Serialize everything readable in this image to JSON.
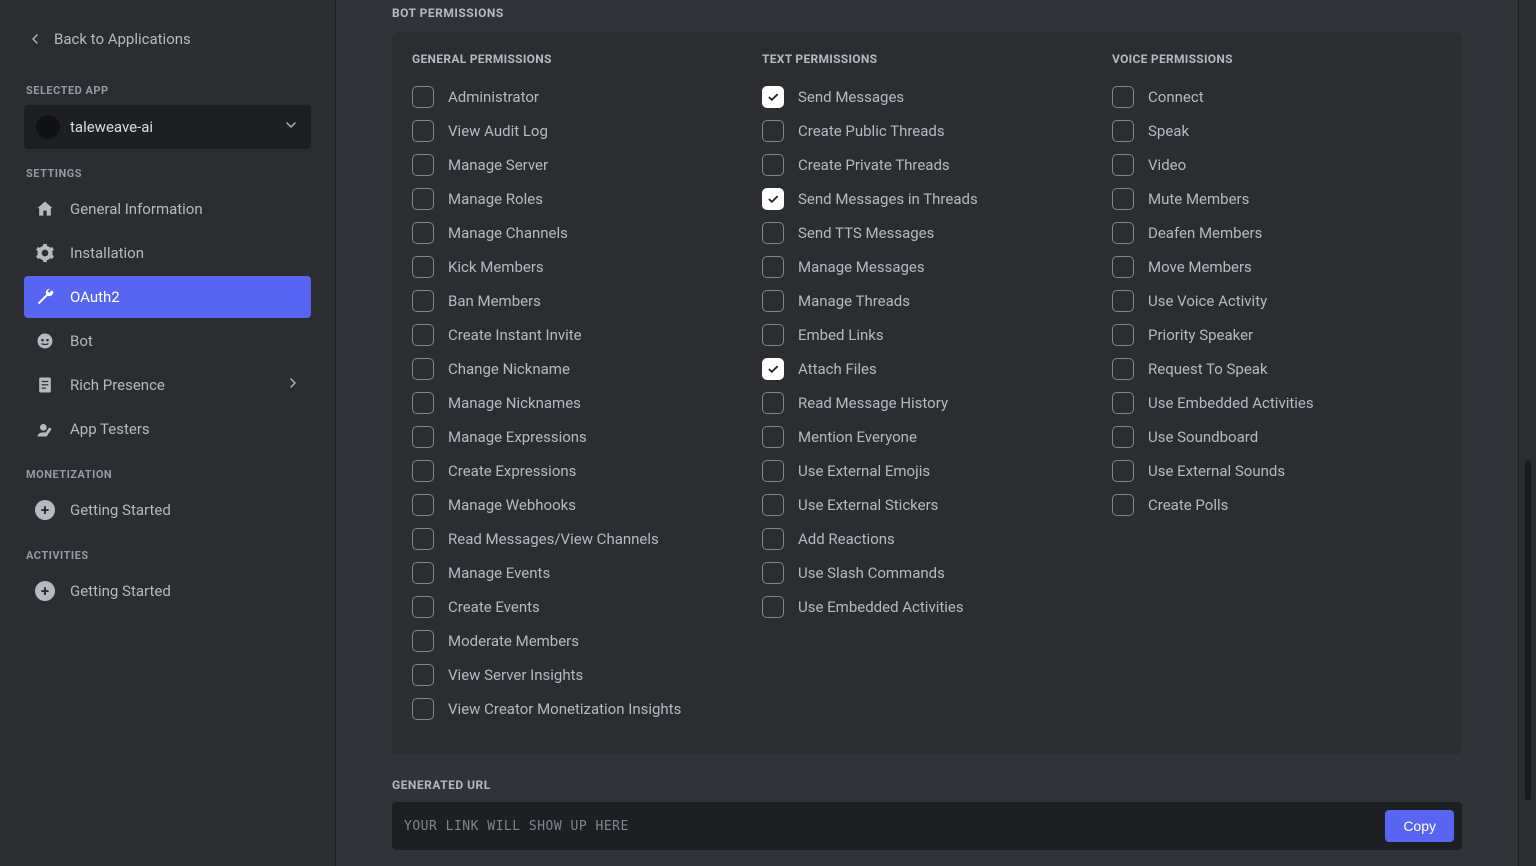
{
  "sidebar": {
    "back": "Back to Applications",
    "selected_app_header": "SELECTED APP",
    "app_name": "taleweave-ai",
    "settings_header": "SETTINGS",
    "nav": {
      "general": "General Information",
      "installation": "Installation",
      "oauth2": "OAuth2",
      "bot": "Bot",
      "rich_presence": "Rich Presence",
      "app_testers": "App Testers"
    },
    "monetization_header": "MONETIZATION",
    "monetization_getting_started": "Getting Started",
    "activities_header": "ACTIVITIES",
    "activities_getting_started": "Getting Started"
  },
  "main": {
    "title": "BOT PERMISSIONS",
    "columns": {
      "general": {
        "header": "GENERAL PERMISSIONS",
        "items": [
          {
            "label": "Administrator",
            "checked": false
          },
          {
            "label": "View Audit Log",
            "checked": false
          },
          {
            "label": "Manage Server",
            "checked": false
          },
          {
            "label": "Manage Roles",
            "checked": false
          },
          {
            "label": "Manage Channels",
            "checked": false
          },
          {
            "label": "Kick Members",
            "checked": false
          },
          {
            "label": "Ban Members",
            "checked": false
          },
          {
            "label": "Create Instant Invite",
            "checked": false
          },
          {
            "label": "Change Nickname",
            "checked": false
          },
          {
            "label": "Manage Nicknames",
            "checked": false
          },
          {
            "label": "Manage Expressions",
            "checked": false
          },
          {
            "label": "Create Expressions",
            "checked": false
          },
          {
            "label": "Manage Webhooks",
            "checked": false
          },
          {
            "label": "Read Messages/View Channels",
            "checked": false
          },
          {
            "label": "Manage Events",
            "checked": false
          },
          {
            "label": "Create Events",
            "checked": false
          },
          {
            "label": "Moderate Members",
            "checked": false
          },
          {
            "label": "View Server Insights",
            "checked": false
          },
          {
            "label": "View Creator Monetization Insights",
            "checked": false
          }
        ]
      },
      "text": {
        "header": "TEXT PERMISSIONS",
        "items": [
          {
            "label": "Send Messages",
            "checked": true
          },
          {
            "label": "Create Public Threads",
            "checked": false
          },
          {
            "label": "Create Private Threads",
            "checked": false
          },
          {
            "label": "Send Messages in Threads",
            "checked": true
          },
          {
            "label": "Send TTS Messages",
            "checked": false
          },
          {
            "label": "Manage Messages",
            "checked": false
          },
          {
            "label": "Manage Threads",
            "checked": false
          },
          {
            "label": "Embed Links",
            "checked": false
          },
          {
            "label": "Attach Files",
            "checked": true
          },
          {
            "label": "Read Message History",
            "checked": false
          },
          {
            "label": "Mention Everyone",
            "checked": false
          },
          {
            "label": "Use External Emojis",
            "checked": false
          },
          {
            "label": "Use External Stickers",
            "checked": false
          },
          {
            "label": "Add Reactions",
            "checked": false
          },
          {
            "label": "Use Slash Commands",
            "checked": false
          },
          {
            "label": "Use Embedded Activities",
            "checked": false
          }
        ]
      },
      "voice": {
        "header": "VOICE PERMISSIONS",
        "items": [
          {
            "label": "Connect",
            "checked": false
          },
          {
            "label": "Speak",
            "checked": false
          },
          {
            "label": "Video",
            "checked": false
          },
          {
            "label": "Mute Members",
            "checked": false
          },
          {
            "label": "Deafen Members",
            "checked": false
          },
          {
            "label": "Move Members",
            "checked": false
          },
          {
            "label": "Use Voice Activity",
            "checked": false
          },
          {
            "label": "Priority Speaker",
            "checked": false
          },
          {
            "label": "Request To Speak",
            "checked": false
          },
          {
            "label": "Use Embedded Activities",
            "checked": false
          },
          {
            "label": "Use Soundboard",
            "checked": false
          },
          {
            "label": "Use External Sounds",
            "checked": false
          },
          {
            "label": "Create Polls",
            "checked": false
          }
        ]
      }
    },
    "generated_url_header": "GENERATED URL",
    "url_placeholder": "YOUR LINK WILL SHOW UP HERE",
    "copy_label": "Copy"
  }
}
